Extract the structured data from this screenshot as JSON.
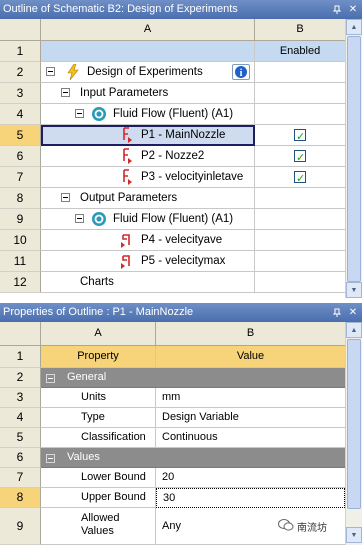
{
  "outline": {
    "title": "Outline of Schematic B2: Design of Experiments",
    "col_a": "A",
    "col_b": "B",
    "rows": [
      {
        "num": "1",
        "a": "",
        "b": "Enabled"
      },
      {
        "num": "2",
        "a": "Design of Experiments",
        "b": ""
      },
      {
        "num": "3",
        "a": "Input Parameters",
        "b": ""
      },
      {
        "num": "4",
        "a": "Fluid Flow (Fluent) (A1)",
        "b": ""
      },
      {
        "num": "5",
        "a": "P1 - MainNozzle",
        "b": ""
      },
      {
        "num": "6",
        "a": "P2 - Nozze2",
        "b": ""
      },
      {
        "num": "7",
        "a": "P3 - velocityinletave",
        "b": ""
      },
      {
        "num": "8",
        "a": "Output Parameters",
        "b": ""
      },
      {
        "num": "9",
        "a": "Fluid Flow (Fluent) (A1)",
        "b": ""
      },
      {
        "num": "10",
        "a": "P4 - velecityave",
        "b": ""
      },
      {
        "num": "11",
        "a": "P5 - velecitymax",
        "b": ""
      },
      {
        "num": "12",
        "a": "Charts",
        "b": ""
      }
    ],
    "checked_rows": [
      "5",
      "6",
      "7"
    ]
  },
  "properties": {
    "title": "Properties of Outline : P1 - MainNozzle",
    "col_a": "A",
    "col_b": "B",
    "header": {
      "num": "1",
      "a": "Property",
      "b": "Value"
    },
    "groups": {
      "general": "General",
      "values": "Values"
    },
    "rows": [
      {
        "num": "2",
        "group": "General"
      },
      {
        "num": "3",
        "a": "Units",
        "b": "mm"
      },
      {
        "num": "4",
        "a": "Type",
        "b": "Design Variable"
      },
      {
        "num": "5",
        "a": "Classification",
        "b": "Continuous"
      },
      {
        "num": "6",
        "group": "Values"
      },
      {
        "num": "7",
        "a": "Lower Bound",
        "b": "20"
      },
      {
        "num": "8",
        "a": "Upper Bound",
        "b": "30"
      },
      {
        "num": "9",
        "a": "Allowed Values",
        "b": "Any"
      }
    ]
  },
  "watermark": {
    "text": "南流坊"
  },
  "colors": {
    "selected_row_header": "#f7d37a",
    "group_row": "#8c8c8c",
    "titlebar": "#5a7dbb",
    "enabled_row": "#c5d9f1"
  }
}
